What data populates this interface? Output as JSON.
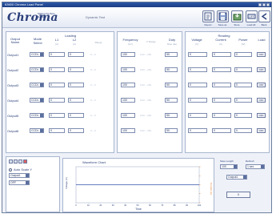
{
  "window": {
    "title": "63600 Chroma Load Panel"
  },
  "header": {
    "logo": "Chroma",
    "slogan": "Making the Best Solution",
    "dynamic_label": "Dynamic Test"
  },
  "toolbar": {
    "items": [
      {
        "label": "Report",
        "icon": "report-icon"
      },
      {
        "label": "Save as",
        "icon": "save-as-icon"
      },
      {
        "label": "Store",
        "icon": "store-icon"
      },
      {
        "label": "Load All",
        "icon": "load-all-icon"
      },
      {
        "label": "Back",
        "icon": "back-icon"
      }
    ]
  },
  "columns": {
    "output_name": "Output Name",
    "mode": "Mode",
    "mode_sub": "Select",
    "loading": "Loading",
    "l1": "L1",
    "l1_unit": "(A)",
    "l2": "L2",
    "l2_unit": "(A)",
    "range": "Range",
    "frequency": "Frequency",
    "frequency_unit": "(Hz)",
    "f_range": "F Range",
    "duty": "Duty",
    "duty_unit": "Rise rate",
    "reading": "Reading",
    "voltage": "Voltage",
    "voltage_unit": "(V)",
    "current": "Current",
    "current_unit": "(A)",
    "power": "Power",
    "power_unit": "(W)",
    "load": "Load"
  },
  "rows": [
    {
      "name": "Output1",
      "mode": "CCDL",
      "l1": "0",
      "l2": "0",
      "range": "0 ~ 0",
      "freq": "100",
      "frange": "0.02 ~ 20k",
      "duty": "50",
      "voltage": "0",
      "current": "0",
      "power": "0",
      "load": "OFF"
    },
    {
      "name": "Output2",
      "mode": "CCDL",
      "l1": "0",
      "l2": "0",
      "range": "0 ~ 0",
      "freq": "100",
      "frange": "0.02 ~ 20k",
      "duty": "50",
      "voltage": "0",
      "current": "0",
      "power": "0",
      "load": "OFF"
    },
    {
      "name": "Output3",
      "mode": "CCDL",
      "l1": "0",
      "l2": "0",
      "range": "0 ~ 0",
      "freq": "100",
      "frange": "0.02 ~ 20k",
      "duty": "50",
      "voltage": "0",
      "current": "0",
      "power": "0",
      "load": "OFF"
    },
    {
      "name": "Output4",
      "mode": "CCDL",
      "l1": "0",
      "l2": "0",
      "range": "0 ~ 0",
      "freq": "100",
      "frange": "0.02 ~ 20k",
      "duty": "50",
      "voltage": "0",
      "current": "0",
      "power": "0",
      "load": "OFF"
    },
    {
      "name": "Output5",
      "mode": "CCDL",
      "l1": "0",
      "l2": "0",
      "range": "0 ~ 0",
      "freq": "100",
      "frange": "0.02 ~ 20k",
      "duty": "50",
      "voltage": "0",
      "current": "0",
      "power": "0",
      "load": "OFF"
    },
    {
      "name": "Output6",
      "mode": "CCDL",
      "l1": "0",
      "l2": "0",
      "range": "0 ~ 0",
      "freq": "100",
      "frange": "0.02 ~ 20k",
      "duty": "50",
      "voltage": "0",
      "current": "0",
      "power": "0",
      "load": "OFF"
    }
  ],
  "chart_controls": {
    "auto_scale": "Auto Scale Y",
    "output_select": "Output1",
    "off_label": "OFF"
  },
  "chart": {
    "title": "Waveform Chart",
    "ylabel_left": "Voltage (V)",
    "ylabel_right": "Current (A)",
    "xlabel": "Time"
  },
  "right_controls": {
    "save_length": "Save Length",
    "save_length_value": "100",
    "refresh": "Refresh",
    "refresh_value": "1 sec",
    "output_select": "Output1",
    "zero_button": "0"
  },
  "chart_data": {
    "type": "line",
    "title": "Waveform Chart",
    "xlabel": "Time",
    "ylabel": "Voltage (V)",
    "x": [
      0,
      10,
      20,
      30,
      40,
      50,
      60,
      70,
      80,
      90,
      100
    ],
    "series": [
      {
        "name": "Voltage",
        "values": [
          0,
          0,
          0,
          0,
          0,
          0,
          0,
          0,
          0,
          0,
          0
        ]
      }
    ],
    "xlim": [
      0,
      100
    ],
    "ylim": [
      -0.1,
      0.1
    ],
    "grid": false
  },
  "colors": {
    "brand": "#2a3f7a",
    "title_bar": "#2c57a8",
    "chart_right_axis": "#e07a2a"
  }
}
